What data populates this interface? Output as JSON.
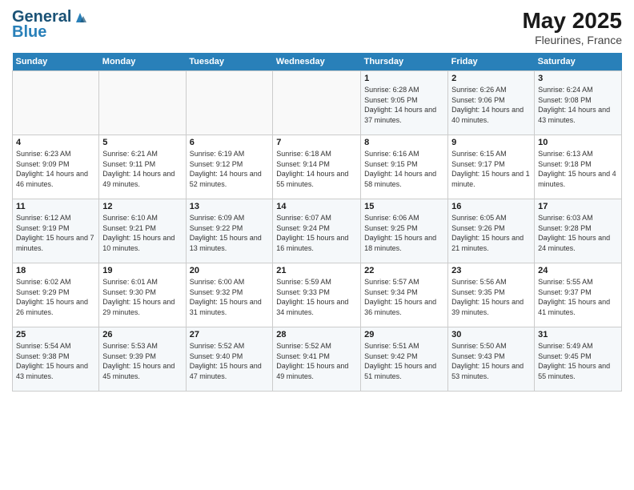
{
  "header": {
    "logo_general": "General",
    "logo_blue": "Blue",
    "title": "May 2025",
    "subtitle": "Fleurines, France"
  },
  "calendar": {
    "days_of_week": [
      "Sunday",
      "Monday",
      "Tuesday",
      "Wednesday",
      "Thursday",
      "Friday",
      "Saturday"
    ],
    "weeks": [
      [
        {
          "day": "",
          "info": ""
        },
        {
          "day": "",
          "info": ""
        },
        {
          "day": "",
          "info": ""
        },
        {
          "day": "",
          "info": ""
        },
        {
          "day": "1",
          "info": "Sunrise: 6:28 AM\nSunset: 9:05 PM\nDaylight: 14 hours\nand 37 minutes."
        },
        {
          "day": "2",
          "info": "Sunrise: 6:26 AM\nSunset: 9:06 PM\nDaylight: 14 hours\nand 40 minutes."
        },
        {
          "day": "3",
          "info": "Sunrise: 6:24 AM\nSunset: 9:08 PM\nDaylight: 14 hours\nand 43 minutes."
        }
      ],
      [
        {
          "day": "4",
          "info": "Sunrise: 6:23 AM\nSunset: 9:09 PM\nDaylight: 14 hours\nand 46 minutes."
        },
        {
          "day": "5",
          "info": "Sunrise: 6:21 AM\nSunset: 9:11 PM\nDaylight: 14 hours\nand 49 minutes."
        },
        {
          "day": "6",
          "info": "Sunrise: 6:19 AM\nSunset: 9:12 PM\nDaylight: 14 hours\nand 52 minutes."
        },
        {
          "day": "7",
          "info": "Sunrise: 6:18 AM\nSunset: 9:14 PM\nDaylight: 14 hours\nand 55 minutes."
        },
        {
          "day": "8",
          "info": "Sunrise: 6:16 AM\nSunset: 9:15 PM\nDaylight: 14 hours\nand 58 minutes."
        },
        {
          "day": "9",
          "info": "Sunrise: 6:15 AM\nSunset: 9:17 PM\nDaylight: 15 hours\nand 1 minute."
        },
        {
          "day": "10",
          "info": "Sunrise: 6:13 AM\nSunset: 9:18 PM\nDaylight: 15 hours\nand 4 minutes."
        }
      ],
      [
        {
          "day": "11",
          "info": "Sunrise: 6:12 AM\nSunset: 9:19 PM\nDaylight: 15 hours\nand 7 minutes."
        },
        {
          "day": "12",
          "info": "Sunrise: 6:10 AM\nSunset: 9:21 PM\nDaylight: 15 hours\nand 10 minutes."
        },
        {
          "day": "13",
          "info": "Sunrise: 6:09 AM\nSunset: 9:22 PM\nDaylight: 15 hours\nand 13 minutes."
        },
        {
          "day": "14",
          "info": "Sunrise: 6:07 AM\nSunset: 9:24 PM\nDaylight: 15 hours\nand 16 minutes."
        },
        {
          "day": "15",
          "info": "Sunrise: 6:06 AM\nSunset: 9:25 PM\nDaylight: 15 hours\nand 18 minutes."
        },
        {
          "day": "16",
          "info": "Sunrise: 6:05 AM\nSunset: 9:26 PM\nDaylight: 15 hours\nand 21 minutes."
        },
        {
          "day": "17",
          "info": "Sunrise: 6:03 AM\nSunset: 9:28 PM\nDaylight: 15 hours\nand 24 minutes."
        }
      ],
      [
        {
          "day": "18",
          "info": "Sunrise: 6:02 AM\nSunset: 9:29 PM\nDaylight: 15 hours\nand 26 minutes."
        },
        {
          "day": "19",
          "info": "Sunrise: 6:01 AM\nSunset: 9:30 PM\nDaylight: 15 hours\nand 29 minutes."
        },
        {
          "day": "20",
          "info": "Sunrise: 6:00 AM\nSunset: 9:32 PM\nDaylight: 15 hours\nand 31 minutes."
        },
        {
          "day": "21",
          "info": "Sunrise: 5:59 AM\nSunset: 9:33 PM\nDaylight: 15 hours\nand 34 minutes."
        },
        {
          "day": "22",
          "info": "Sunrise: 5:57 AM\nSunset: 9:34 PM\nDaylight: 15 hours\nand 36 minutes."
        },
        {
          "day": "23",
          "info": "Sunrise: 5:56 AM\nSunset: 9:35 PM\nDaylight: 15 hours\nand 39 minutes."
        },
        {
          "day": "24",
          "info": "Sunrise: 5:55 AM\nSunset: 9:37 PM\nDaylight: 15 hours\nand 41 minutes."
        }
      ],
      [
        {
          "day": "25",
          "info": "Sunrise: 5:54 AM\nSunset: 9:38 PM\nDaylight: 15 hours\nand 43 minutes."
        },
        {
          "day": "26",
          "info": "Sunrise: 5:53 AM\nSunset: 9:39 PM\nDaylight: 15 hours\nand 45 minutes."
        },
        {
          "day": "27",
          "info": "Sunrise: 5:52 AM\nSunset: 9:40 PM\nDaylight: 15 hours\nand 47 minutes."
        },
        {
          "day": "28",
          "info": "Sunrise: 5:52 AM\nSunset: 9:41 PM\nDaylight: 15 hours\nand 49 minutes."
        },
        {
          "day": "29",
          "info": "Sunrise: 5:51 AM\nSunset: 9:42 PM\nDaylight: 15 hours\nand 51 minutes."
        },
        {
          "day": "30",
          "info": "Sunrise: 5:50 AM\nSunset: 9:43 PM\nDaylight: 15 hours\nand 53 minutes."
        },
        {
          "day": "31",
          "info": "Sunrise: 5:49 AM\nSunset: 9:45 PM\nDaylight: 15 hours\nand 55 minutes."
        }
      ]
    ]
  }
}
